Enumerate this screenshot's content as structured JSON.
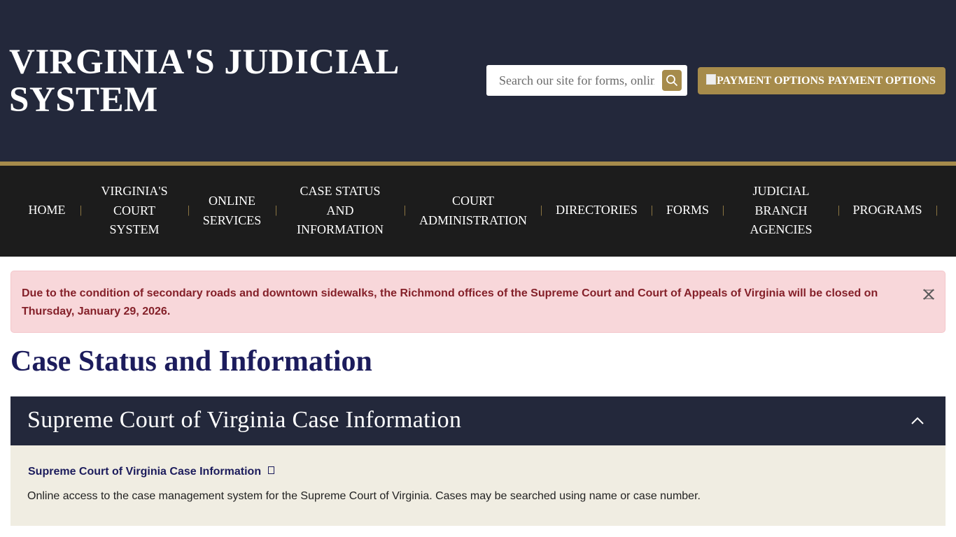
{
  "header": {
    "site_title": "VIRGINIA'S JUDICIAL SYSTEM",
    "search_placeholder": "Search our site for forms, online services, and more",
    "search_icon": "search-icon",
    "payment_alt": "PAYMENT OPTIONS",
    "payment_label": "PAYMENT OPTIONS"
  },
  "nav": {
    "items": [
      {
        "label": "HOME"
      },
      {
        "label": "VIRGINIA'S COURT SYSTEM"
      },
      {
        "label": "ONLINE SERVICES"
      },
      {
        "label": "CASE STATUS AND INFORMATION"
      },
      {
        "label": "COURT ADMINISTRATION"
      },
      {
        "label": "DIRECTORIES"
      },
      {
        "label": "FORMS"
      },
      {
        "label": "JUDICIAL BRANCH AGENCIES"
      },
      {
        "label": "PROGRAMS"
      }
    ],
    "separator": "|"
  },
  "alert": {
    "text": "Due to the condition of secondary roads and downtown sidewalks, the Richmond offices of the Supreme Court and Court of Appeals of Virginia will be closed on Thursday, January 29, 2026.",
    "close_icon": "close-icon"
  },
  "main": {
    "page_title": "Case Status and Information",
    "accordion": {
      "title": "Supreme Court of Virginia Case Information",
      "toggle_icon": "chevron-up-icon",
      "link_label": "Supreme Court of Virginia Case Information",
      "link_icon": "external-link-icon",
      "description": "Online access to the case management system for the Supreme Court of Virginia. Cases may be searched using name or case number."
    }
  },
  "colors": {
    "header_bg": "#23283b",
    "gold": "#a68b4b",
    "nav_bg": "#1c1c1c",
    "alert_bg": "#f8d7da",
    "alert_text": "#842029",
    "title_navy": "#1c1c5c",
    "accordion_body_bg": "#f0ede2"
  }
}
